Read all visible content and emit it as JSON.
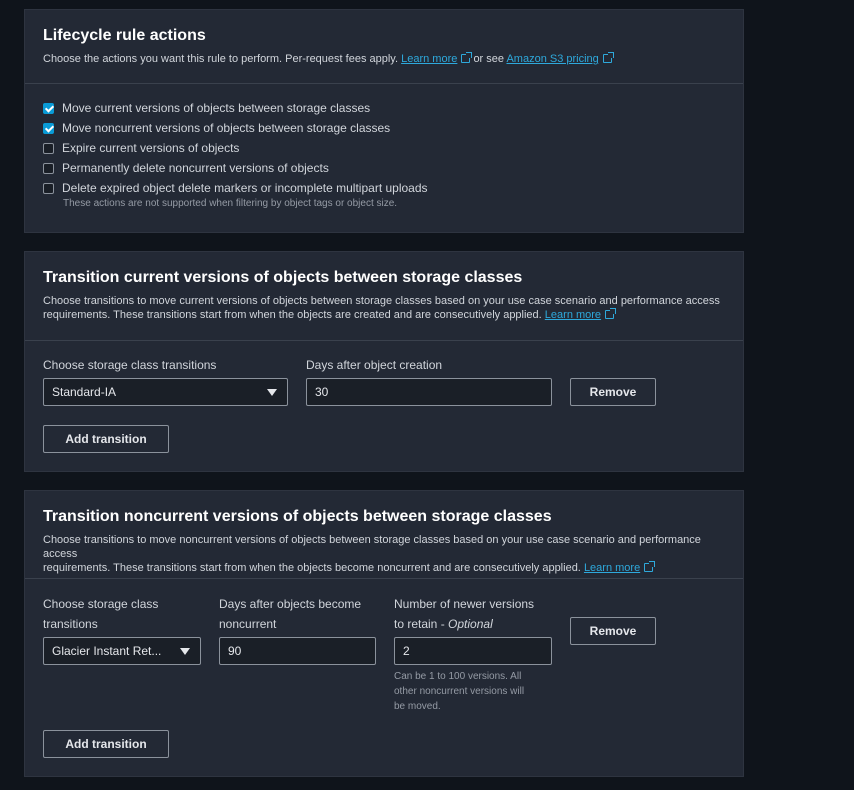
{
  "section1": {
    "title": "Lifecycle rule actions",
    "desc_prefix": "Choose the actions you want this rule to perform. Per-request fees apply.",
    "learn_more": "Learn more",
    "or_see": "or see",
    "pricing_link": "Amazon S3 pricing",
    "options": [
      {
        "label": "Move current versions of objects between storage classes",
        "checked": true
      },
      {
        "label": "Move noncurrent versions of objects between storage classes",
        "checked": true
      },
      {
        "label": "Expire current versions of objects",
        "checked": false
      },
      {
        "label": "Permanently delete noncurrent versions of objects",
        "checked": false
      },
      {
        "label": "Delete expired object delete markers or incomplete multipart uploads",
        "checked": false
      }
    ],
    "note": "These actions are not supported when filtering by object tags or object size."
  },
  "section2": {
    "title": "Transition current versions of objects between storage classes",
    "desc_line1": "Choose transitions to move current versions of objects between storage classes based on your use case scenario and performance access",
    "desc_line2": "requirements. These transitions start from when the objects are created and are consecutively applied.",
    "learn_more": "Learn more",
    "storage_label": "Choose storage class transitions",
    "storage_value": "Standard-IA",
    "days_label": "Days after object creation",
    "days_value": "30",
    "remove": "Remove",
    "add": "Add transition"
  },
  "section3": {
    "title": "Transition noncurrent versions of objects between storage classes",
    "desc_line1": "Choose transitions to move noncurrent versions of objects between storage classes based on your use case scenario and performance access",
    "desc_line2": "requirements. These transitions start from when the objects become noncurrent and are consecutively applied.",
    "learn_more": "Learn more",
    "storage_label_1": "Choose storage class",
    "storage_label_2": "transitions",
    "storage_value": "Glacier Instant Ret...",
    "days_label_1": "Days after objects become",
    "days_label_2": "noncurrent",
    "days_value": "90",
    "versions_label_1": "Number of newer versions",
    "versions_label_2": "to retain -",
    "versions_optional": "Optional",
    "versions_value": "2",
    "versions_hint_1": "Can be 1 to 100 versions. All",
    "versions_hint_2": "other noncurrent versions will",
    "versions_hint_3": "be moved.",
    "remove": "Remove",
    "add": "Add transition"
  }
}
